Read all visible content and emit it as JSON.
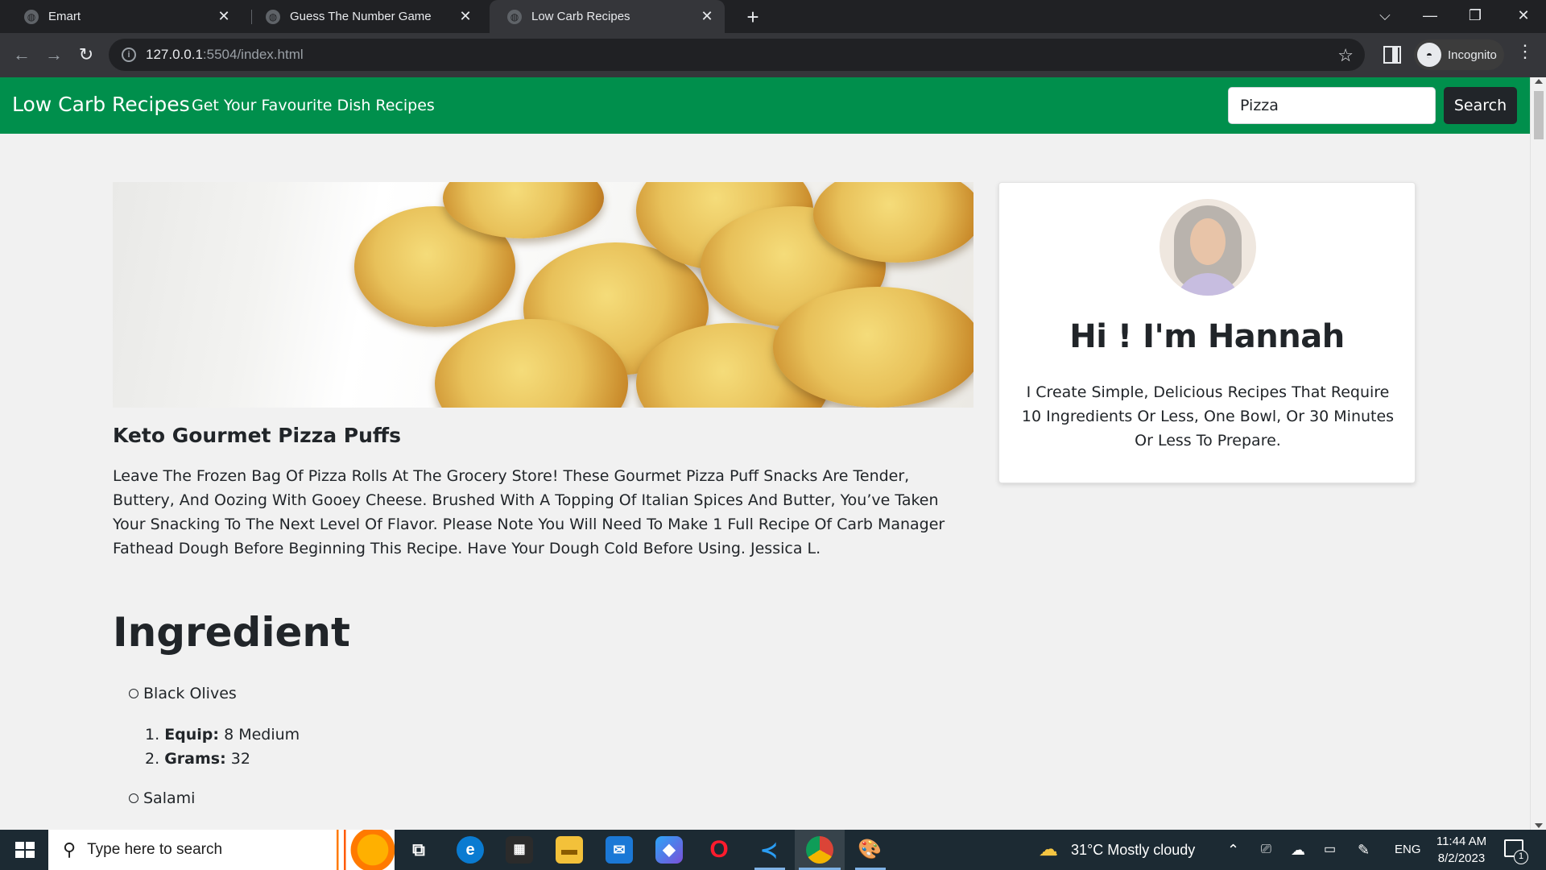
{
  "browser": {
    "tabs": [
      {
        "title": "Emart",
        "close": "✕"
      },
      {
        "title": "Guess The Number Game",
        "close": "✕"
      },
      {
        "title": "Low Carb Recipes",
        "close": "✕"
      }
    ],
    "new_tab": "+",
    "url_host": "127.0.0.1",
    "url_path": ":5504/index.html",
    "profile_label": "Incognito",
    "window_controls": {
      "dropdown": "⌵",
      "minimize": "—",
      "restore": "❐",
      "close": "✕"
    },
    "nav_icons": {
      "back": "←",
      "forward": "→",
      "reload": "↻",
      "info": "i",
      "star": "☆",
      "menu": "⋮"
    }
  },
  "navbar": {
    "brand": "Low Carb Recipes",
    "link": "Get Your Favourite Dish Recipes",
    "search_value": "Pizza",
    "search_button": "Search"
  },
  "recipe": {
    "title": "Keto Gourmet Pizza Puffs",
    "description": "Leave The Frozen Bag Of Pizza Rolls At The Grocery Store! These Gourmet Pizza Puff Snacks Are Tender, Buttery, And Oozing With Gooey Cheese. Brushed With A Topping Of Italian Spices And Butter, You’ve Taken Your Snacking To The Next Level Of Flavor. Please Note You Will Need To Make 1 Full Recipe Of Carb Manager Fathead Dough Before Beginning This Recipe. Have Your Dough Cold Before Using. Jessica L."
  },
  "author": {
    "name": "Hi ! I'm Hannah",
    "bio": "I Create Simple, Delicious Recipes That Require 10 Ingredients Or Less, One Bowl, Or 30 Minutes Or Less To Prepare."
  },
  "ingredients": {
    "heading": "Ingredient",
    "items": [
      {
        "name": "Black Olives",
        "details": [
          {
            "num": "1.",
            "label": "Equip:",
            "value": "8 Medium"
          },
          {
            "num": "2.",
            "label": "Grams:",
            "value": "32"
          }
        ]
      },
      {
        "name": "Salami",
        "details": []
      }
    ]
  },
  "taskbar": {
    "search_placeholder": "Type here to search",
    "weather": "31°C  Mostly cloudy",
    "language": "ENG",
    "time": "11:44 AM",
    "date": "8/2/2023",
    "notification_count": "1"
  }
}
